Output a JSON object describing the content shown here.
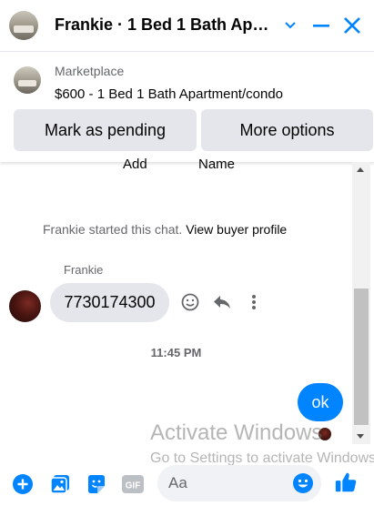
{
  "header": {
    "title": "Frankie · 1 Bed 1 Bath Apar...",
    "avatar_icon": "listing-photo",
    "chevron_icon": "chevron-down-icon",
    "minimize_icon": "minimize-icon",
    "close_icon": "close-icon",
    "accent_color": "#0084ff"
  },
  "listing": {
    "source": "Marketplace",
    "description": "$600 - 1 Bed 1 Bath Apartment/condo",
    "mark_pending_label": "Mark as pending",
    "more_options_label": "More options"
  },
  "chat": {
    "partial_left": "Add",
    "partial_right": "Name",
    "started_text": "Frankie started this chat.",
    "view_profile_link": "View buyer profile",
    "sender_name": "Frankie",
    "incoming_message": "7730174300",
    "timestamp": "11:45 PM",
    "outgoing_message": "ok"
  },
  "watermark": {
    "line1": "Activate Windows",
    "line2": "Go to Settings to activate Windows."
  },
  "composer": {
    "placeholder": "Aa",
    "icons": [
      "plus-icon",
      "photo-icon",
      "sticker-icon",
      "gif-icon",
      "emoji-icon",
      "thumbs-up-icon"
    ],
    "gif_label": "GIF"
  }
}
